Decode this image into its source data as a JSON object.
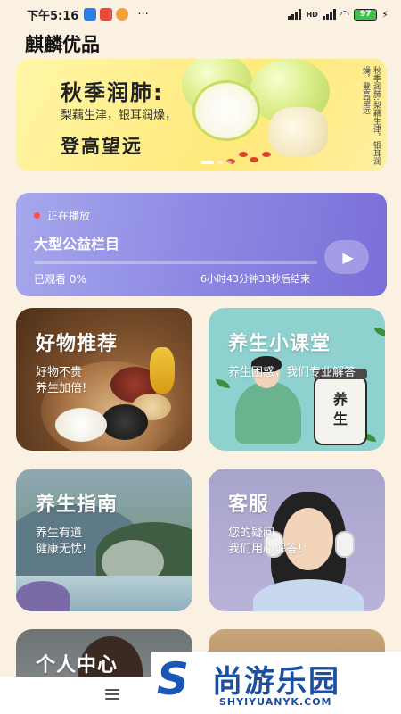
{
  "status_bar": {
    "time": "下午5:16",
    "more": "···",
    "battery": "97",
    "network": "HD"
  },
  "app": {
    "title": "麒麟优品"
  },
  "banner": {
    "headline": "秋季润肺:",
    "subline": "梨藕生津，银耳润燥，",
    "footer": "登高望远",
    "vertical_text": "秋季润肺:梨藕生津，银耳润燥，登高望远"
  },
  "player": {
    "live_label": "正在播放",
    "title": "大型公益栏目",
    "watched": "已观看 0%",
    "progress": 0,
    "remaining": "6小时43分钟38秒后结束",
    "play_icon": "▶"
  },
  "cards": [
    {
      "title": "好物推荐",
      "desc": "好物不贵\n养生加倍!"
    },
    {
      "title": "养生小课堂",
      "desc": "养生困惑，我们专业解答",
      "jar_label": "养生"
    },
    {
      "title": "养生指南",
      "desc": "养生有道\n健康无忧!"
    },
    {
      "title": "客服",
      "desc": "您的疑问\n我们用心解答!"
    },
    {
      "title": "个人中心"
    },
    {
      "title": ""
    }
  ],
  "watermark": {
    "text": "尚游乐园",
    "url": "SHYIYUANYK.COM",
    "letter": "S"
  },
  "colors": {
    "background": "#fbf1e2",
    "player_accent": "#8f8be4",
    "brand_blue": "#1d4fa0"
  }
}
